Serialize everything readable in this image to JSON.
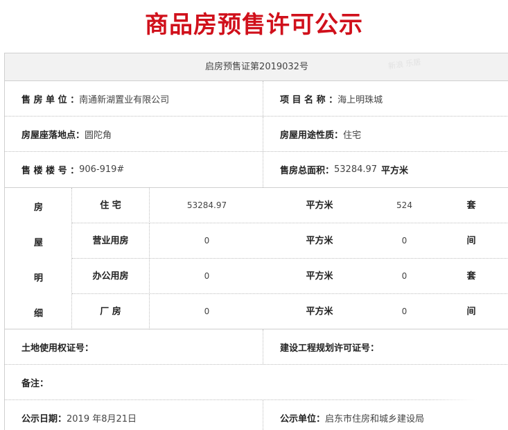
{
  "title": "商品房预售许可公示",
  "certificate": "启房预售证第2019032号",
  "seller_label": "售 房 单 位 ：",
  "seller_value": "南通新湖置业有限公司",
  "project_label": "项 目 名 称 ：",
  "project_value": "海上明珠城",
  "location_label": "房屋座落地点：",
  "location_value": "圆陀角",
  "usage_label": "房屋用途性质：",
  "usage_value": "住宅",
  "building_label": "售 楼 楼 号 ：",
  "building_value": "906-919#",
  "total_area_label": "售房总面积：",
  "total_area_value": "53284.97",
  "total_area_unit": "平方米",
  "detail_title_chars": [
    "房",
    "屋",
    "明",
    "细"
  ],
  "details": [
    {
      "type": "住 宅",
      "area": "53284.97",
      "area_unit": "平方米",
      "count": "524",
      "count_unit": "套"
    },
    {
      "type": "营业用房",
      "area": "0",
      "area_unit": "平方米",
      "count": "0",
      "count_unit": "间"
    },
    {
      "type": "办公用房",
      "area": "0",
      "area_unit": "平方米",
      "count": "0",
      "count_unit": "套"
    },
    {
      "type": "厂 房",
      "area": "0",
      "area_unit": "平方米",
      "count": "0",
      "count_unit": "间"
    }
  ],
  "land_cert_label": "土地使用权证号：",
  "planning_permit_label": "建设工程规划许可证号：",
  "remarks_label": "备注：",
  "date_label": "公示日期：",
  "date_value": "2019 年8月21日",
  "publisher_label": "公示单位：",
  "publisher_value": "启东市住房和城乡建设局",
  "watermark": "新浪 乐居",
  "colors": {
    "title": "#d0101b",
    "border": "#cfcfcf",
    "cert_bg": "#f2f2f2"
  }
}
